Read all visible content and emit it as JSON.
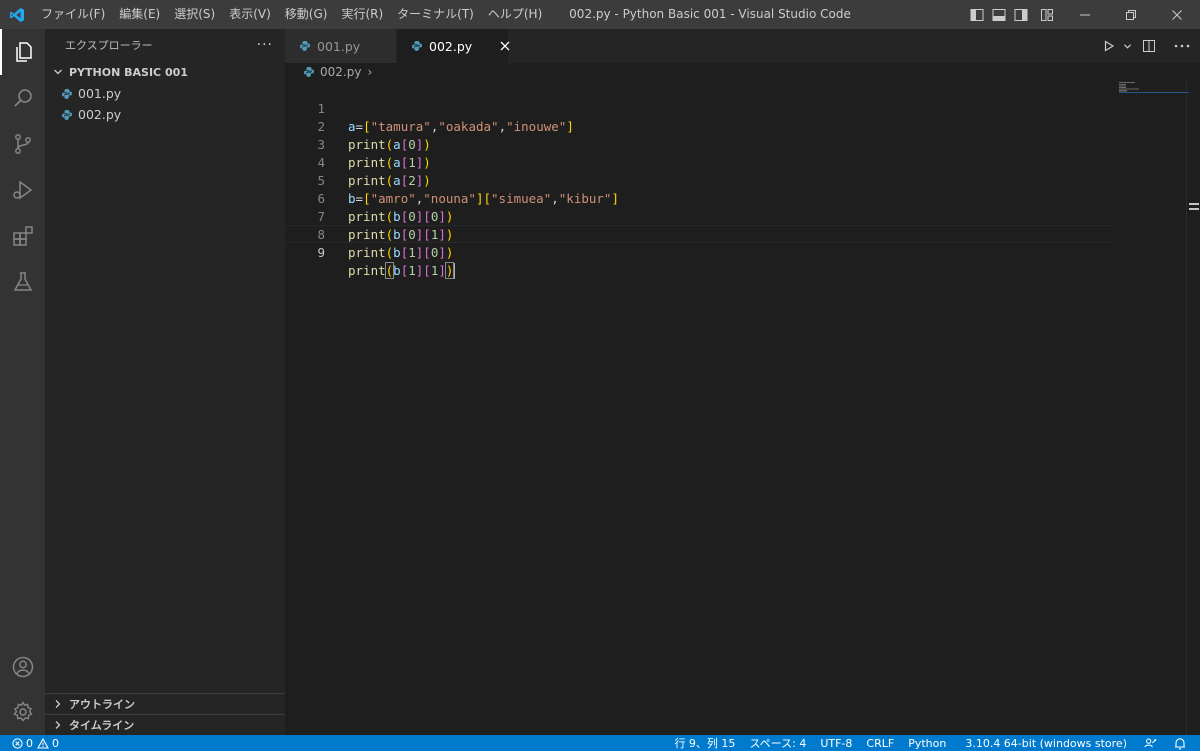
{
  "titlebar": {
    "menu": [
      "ファイル(F)",
      "編集(E)",
      "選択(S)",
      "表示(V)",
      "移動(G)",
      "実行(R)",
      "ターミナル(T)",
      "ヘルプ(H)"
    ],
    "window_title": "002.py - Python Basic 001 - Visual Studio Code"
  },
  "sidebar": {
    "title": "エクスプローラー",
    "more": "···",
    "folder": "PYTHON BASIC 001",
    "files": [
      "001.py",
      "002.py"
    ],
    "sections": [
      "アウトライン",
      "タイムライン"
    ]
  },
  "editor": {
    "tabs": [
      {
        "label": "001.py",
        "active": false
      },
      {
        "label": "002.py",
        "active": true
      }
    ],
    "breadcrumb": {
      "file": "002.py",
      "sep": "›"
    },
    "lines": [
      {
        "num": "1",
        "text": "a=[\"tamura\",\"oakada\",\"inouwe\"]"
      },
      {
        "num": "2",
        "text": "print(a[0])"
      },
      {
        "num": "3",
        "text": "print(a[1])"
      },
      {
        "num": "4",
        "text": "print(a[2])"
      },
      {
        "num": "5",
        "text": "b=[\"amro\",\"nouna\"][\"simuea\",\"kibur\"]"
      },
      {
        "num": "6",
        "text": "print(b[0][0])"
      },
      {
        "num": "7",
        "text": "print(b[0][1])"
      },
      {
        "num": "8",
        "text": "print(b[1][0])"
      },
      {
        "num": "9",
        "text": "print(b[1][1])"
      }
    ],
    "current_line": 9
  },
  "statusbar": {
    "errors": "0",
    "warnings": "0",
    "position": "行 9、列 15",
    "spaces": "スペース: 4",
    "encoding": "UTF-8",
    "eol": "CRLF",
    "language": "Python",
    "interpreter": "3.10.4 64-bit (windows store)"
  },
  "colors": {
    "keyword_blue": "#9cdcfe",
    "function_yellow": "#dcdcaa",
    "string_orange": "#ce9178",
    "number_green": "#b5cea8",
    "bracket_gold": "#ffd700",
    "bracket_purple": "#da70d6",
    "bracket_blue": "#179fff",
    "accent": "#007acc",
    "python_icon": "#519aba"
  },
  "icons": {
    "app": "vscode-logo-icon",
    "explorer": "files-icon",
    "search": "search-icon",
    "scm": "source-control-icon",
    "run": "run-debug-icon",
    "extensions": "extensions-icon",
    "testing": "flask-icon",
    "account": "account-icon",
    "manage": "gear-icon"
  }
}
